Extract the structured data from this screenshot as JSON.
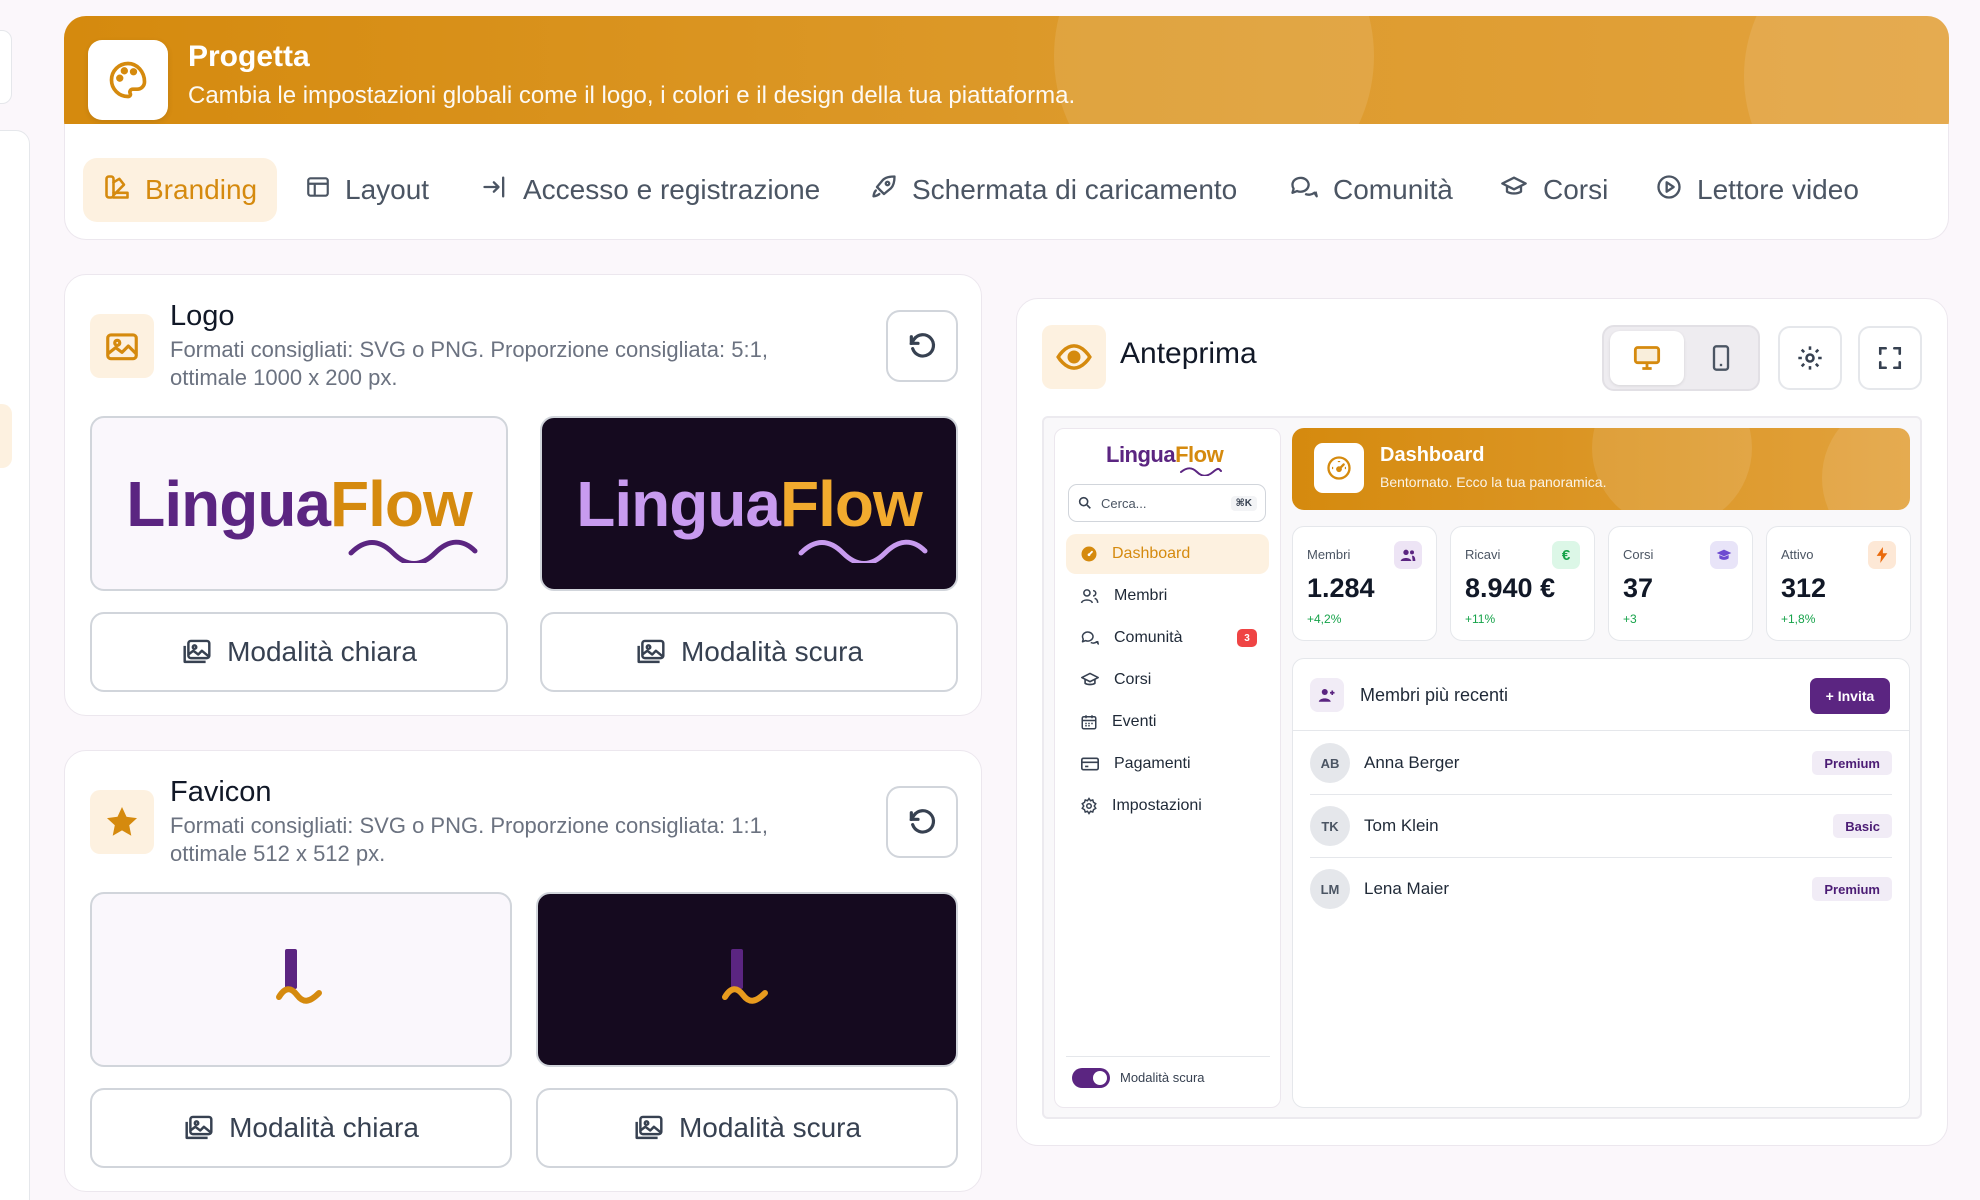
{
  "header": {
    "title": "Progetta",
    "subtitle": "Cambia le impostazioni globali come il logo, i colori e il design della tua piattaforma."
  },
  "tabs": [
    {
      "label": "Branding",
      "icon": "brush-icon",
      "active": true
    },
    {
      "label": "Layout",
      "icon": "layout-icon"
    },
    {
      "label": "Accesso e registrazione",
      "icon": "login-arrow-icon"
    },
    {
      "label": "Schermata di caricamento",
      "icon": "rocket-icon"
    },
    {
      "label": "Comunità",
      "icon": "chat-bubbles-icon"
    },
    {
      "label": "Corsi",
      "icon": "graduation-cap-icon"
    },
    {
      "label": "Lettore video",
      "icon": "play-circle-icon"
    }
  ],
  "logo": {
    "title": "Logo",
    "subtitle_line1": "Formati consigliati: SVG o PNG. Proporzione consigliata: 5:1,",
    "subtitle_line2": "ottimale 1000 x 200 px.",
    "wordmark_a": "Lingua",
    "wordmark_b": "Flow",
    "light_button": "Modalità chiara",
    "dark_button": "Modalità scura"
  },
  "favicon": {
    "title": "Favicon",
    "subtitle_line1": "Formati consigliati: SVG o PNG. Proporzione consigliata: 1:1,",
    "subtitle_line2": "ottimale 512 x 512 px.",
    "light_button": "Modalità chiara",
    "dark_button": "Modalità scura"
  },
  "preview": {
    "title": "Anteprima",
    "app": {
      "brand_a": "Lingua",
      "brand_b": "Flow",
      "search_placeholder": "Cerca...",
      "search_shortcut": "⌘K",
      "nav": [
        {
          "label": "Dashboard",
          "icon": "gauge-icon",
          "active": true
        },
        {
          "label": "Membri",
          "icon": "users-icon"
        },
        {
          "label": "Comunità",
          "icon": "chat-icon",
          "badge": "3"
        },
        {
          "label": "Corsi",
          "icon": "graduation-cap-icon"
        },
        {
          "label": "Eventi",
          "icon": "calendar-icon"
        },
        {
          "label": "Pagamenti",
          "icon": "credit-card-icon"
        },
        {
          "label": "Impostazioni",
          "icon": "settings-icon"
        }
      ],
      "dark_mode_label": "Modalità scura",
      "dash_title": "Dashboard",
      "dash_subtitle": "Bentornato. Ecco la tua panoramica.",
      "stats": [
        {
          "label": "Membri",
          "value": "1.284",
          "delta": "+4,2%",
          "icon": "users-icon"
        },
        {
          "label": "Ricavi",
          "value": "8.940 €",
          "delta": "+11%",
          "icon": "euro-icon"
        },
        {
          "label": "Corsi",
          "value": "37",
          "delta": "+3",
          "icon": "graduation-cap-icon"
        },
        {
          "label": "Attivo",
          "value": "312",
          "delta": "+1,8%",
          "icon": "bolt-icon"
        }
      ],
      "recent_title": "Membri più recenti",
      "invite_label": "+ Invita",
      "members": [
        {
          "initials": "AB",
          "name": "Anna Berger",
          "plan": "Premium"
        },
        {
          "initials": "TK",
          "name": "Tom Klein",
          "plan": "Basic"
        },
        {
          "initials": "LM",
          "name": "Lena Maier",
          "plan": "Premium"
        }
      ]
    }
  },
  "colors": {
    "accent": "#d58a0e",
    "brand_purple": "#5b2581",
    "dark_bg": "#150a1f"
  }
}
